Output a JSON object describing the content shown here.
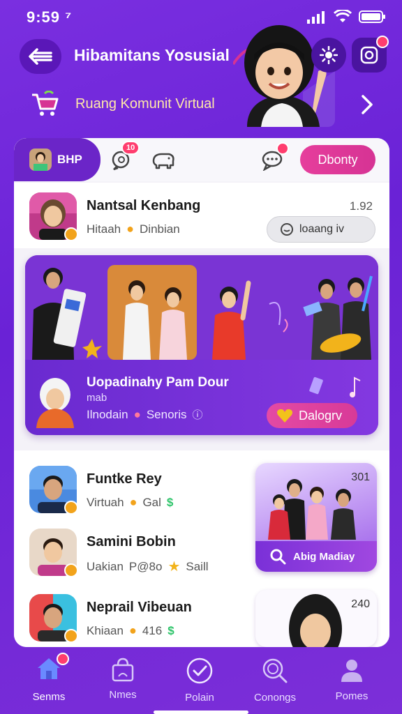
{
  "status": {
    "time": "9:59 ⁷"
  },
  "header": {
    "title": "Hibamitans Yosusial",
    "subtitle": "Ruang Komunit Virtual"
  },
  "tabs": {
    "active_label": "BHP",
    "badge_count": "10",
    "donate_label": "Dbonty"
  },
  "items": [
    {
      "name": "Nantsal Kenbang",
      "meta_left": "Hitaah",
      "meta_right": "Dinbian",
      "count": "1.92",
      "action_label": "loaang iv"
    },
    {
      "name": "Funtke Rey",
      "meta_left": "Virtuah",
      "meta_right": "Gal"
    },
    {
      "name": "Samini Bobin",
      "meta_left": "Uakian",
      "meta_mid": "P@8o",
      "meta_right": "Saill"
    },
    {
      "name": "Neprail Vibeuan",
      "meta_left": "Khiaan",
      "meta_right": "416"
    }
  ],
  "feature": {
    "title": "Uopadinahy Pam Dour",
    "sub": "mab",
    "meta_left": "Ilnodain",
    "meta_right": "Senoris",
    "button_label": "Dalogrv"
  },
  "side_cards": [
    {
      "count": "301",
      "label": "Abig Madiay"
    },
    {
      "count": "240"
    }
  ],
  "nav": [
    {
      "label": "Senms",
      "active": true
    },
    {
      "label": "Nmes"
    },
    {
      "label": "Polain"
    },
    {
      "label": "Conongs"
    },
    {
      "label": "Pomes"
    }
  ],
  "colors": {
    "accent": "#6b25c8",
    "pink": "#e63e9c",
    "badge": "#ff3d6e"
  }
}
